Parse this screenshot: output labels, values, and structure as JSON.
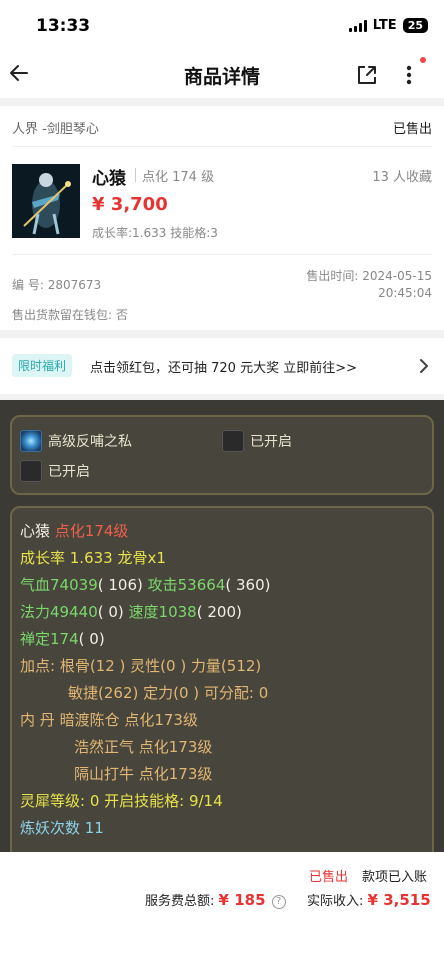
{
  "status_bar": {
    "time": "13:33",
    "network": "LTE",
    "battery": "25"
  },
  "nav": {
    "title": "商品详情"
  },
  "product": {
    "server": "人界 -剑胆琴心",
    "status": "已售出",
    "name": "心猿",
    "level": "点化 174 级",
    "favorites": "13 人收藏",
    "price": "¥ 3,700",
    "attributes": "成长率:1.633 技能格:3",
    "id_label": "编  号:",
    "id_value": "2807673",
    "sold_time_label": "售出时间:",
    "sold_date": "2024-05-15",
    "sold_clock": "20:45:04",
    "wallet_label": "售出货款留在钱包:",
    "wallet_value": "否"
  },
  "promo": {
    "badge": "限时福利",
    "text": "点击领红包，还可抽 720 元大奖 立即前往>>"
  },
  "game": {
    "slot1": "高级反哺之私",
    "slot2": "已开启",
    "slot3": "已开启",
    "name": "心猿",
    "level": "点化174级",
    "growth": "成长率 1.633 龙骨x1",
    "hp_label": "气血",
    "hp": "74039",
    "hp_add": "( 106)",
    "atk_label": "攻击",
    "atk": "53664",
    "atk_add": "( 360)",
    "mp_label": "法力",
    "mp": "49440",
    "mp_add": "( 0)",
    "spd_label": "速度",
    "spd": "1038",
    "spd_add": "( 200)",
    "def_label": "禅定",
    "def": "174",
    "def_add": "( 0)",
    "points1": "加点:  根骨(12 ) 灵性(0 ) 力量(512)",
    "points2": "敏捷(262) 定力(0 ) 可分配:  0",
    "inner_label": "内   丹",
    "inner1": "暗渡陈仓 点化173级",
    "inner2": "浩然正气 点化173级",
    "inner3": "隔山打牛 点化173级",
    "rhino": "灵犀等级:  0 开启技能格:  9/14",
    "refine": "炼妖次数 11"
  },
  "bottom": {
    "sold": "已售出",
    "settled": "款项已入账",
    "fee_label": "服务费总额:",
    "fee": "¥ 185",
    "income_label": "实际收入:",
    "income": "¥ 3,515"
  }
}
